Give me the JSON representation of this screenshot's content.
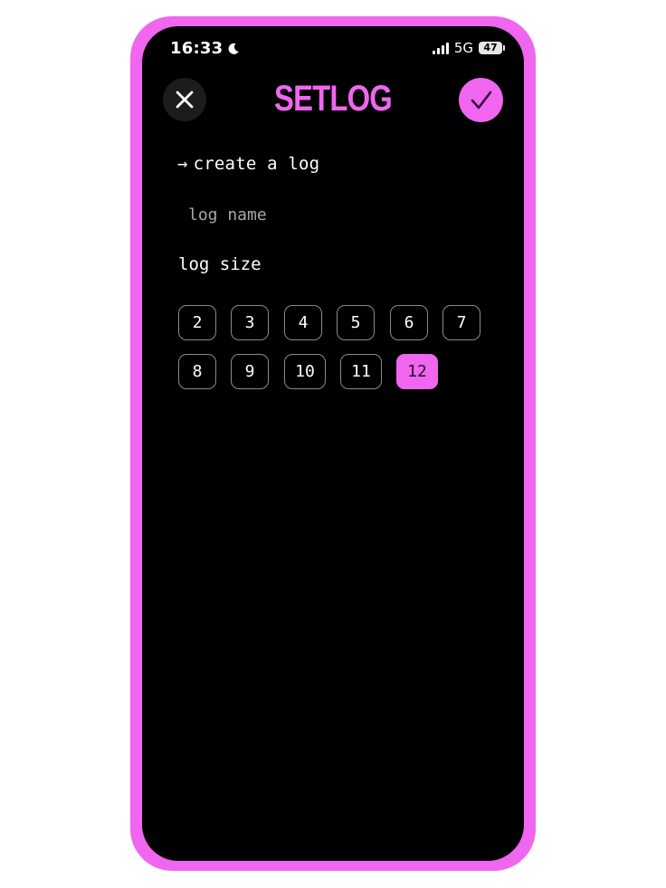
{
  "status_bar": {
    "time": "16:33",
    "network": "5G",
    "battery": "47"
  },
  "header": {
    "logo": "SETLOG"
  },
  "form": {
    "title": "create a log",
    "name_placeholder": "log name",
    "name_value": "",
    "size_label": "log size",
    "sizes": [
      "2",
      "3",
      "4",
      "5",
      "6",
      "7",
      "8",
      "9",
      "10",
      "11",
      "12"
    ],
    "selected_size": "12"
  },
  "colors": {
    "accent": "#f066ef",
    "background": "#000000"
  }
}
